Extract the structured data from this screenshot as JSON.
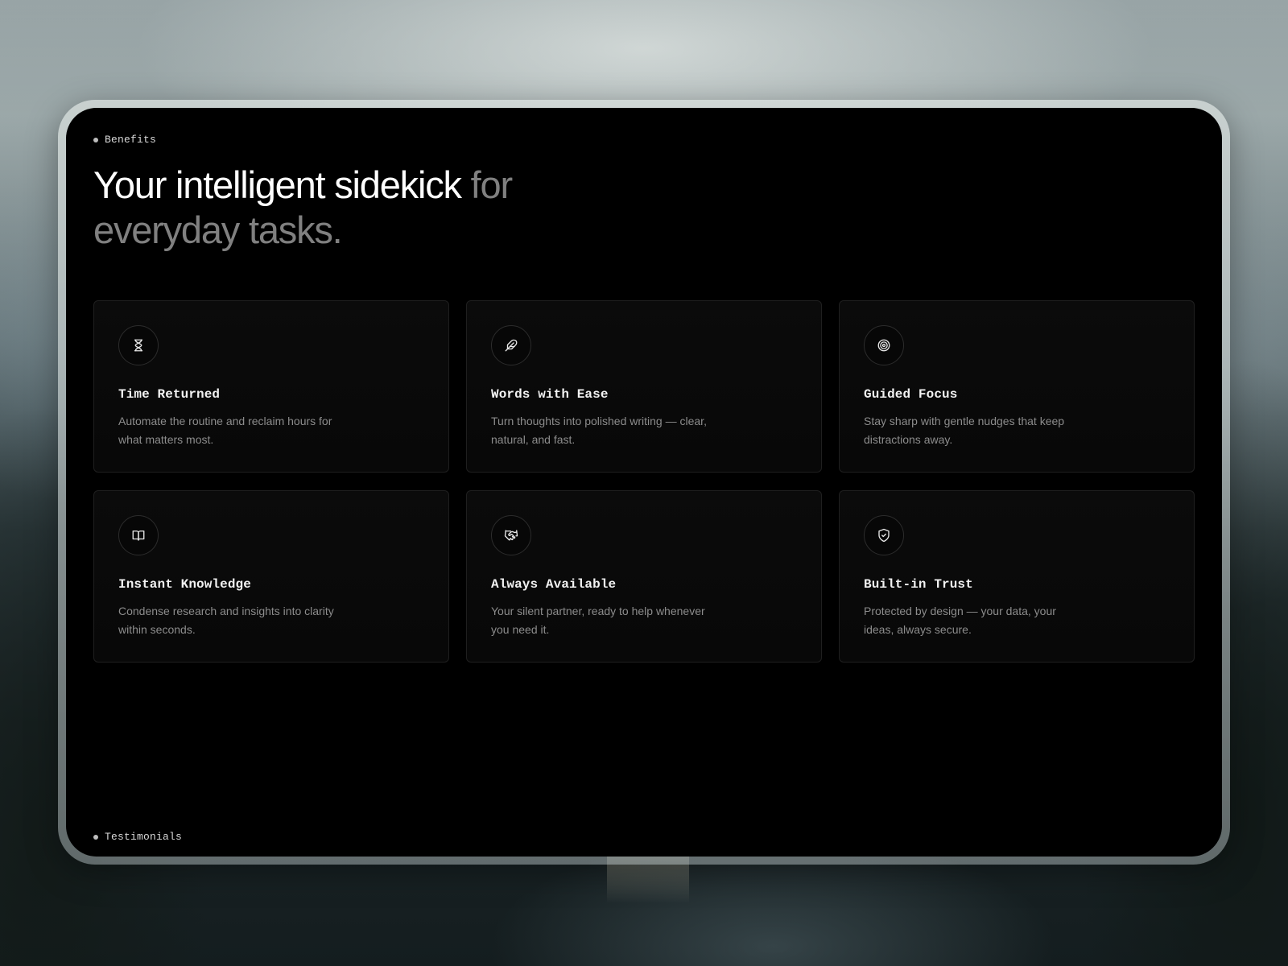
{
  "benefits_tag": "Benefits",
  "testimonials_tag": "Testimonials",
  "headline": {
    "bright": "Your intelligent sidekick",
    "dim": " for everyday tasks."
  },
  "cards": [
    {
      "icon": "hourglass-icon",
      "title": "Time Returned",
      "description": "Automate the routine and reclaim hours for what matters most."
    },
    {
      "icon": "feather-icon",
      "title": "Words with Ease",
      "description": "Turn thoughts into polished writing — clear, natural, and fast."
    },
    {
      "icon": "target-icon",
      "title": "Guided Focus",
      "description": "Stay sharp with gentle nudges that keep distractions away."
    },
    {
      "icon": "book-open-icon",
      "title": "Instant Knowledge",
      "description": "Condense research and insights into clarity within seconds."
    },
    {
      "icon": "handshake-icon",
      "title": "Always Available",
      "description": "Your silent partner, ready to help whenever you need it."
    },
    {
      "icon": "shield-check-icon",
      "title": "Built-in Trust",
      "description": "Protected by design — your data, your ideas, always secure."
    }
  ],
  "colors": {
    "panel_background": "#000000",
    "headline_bright": "#ffffff",
    "headline_dim": "#808080",
    "card_border": "#1f1f1f",
    "description_text": "#8c8c8c"
  }
}
